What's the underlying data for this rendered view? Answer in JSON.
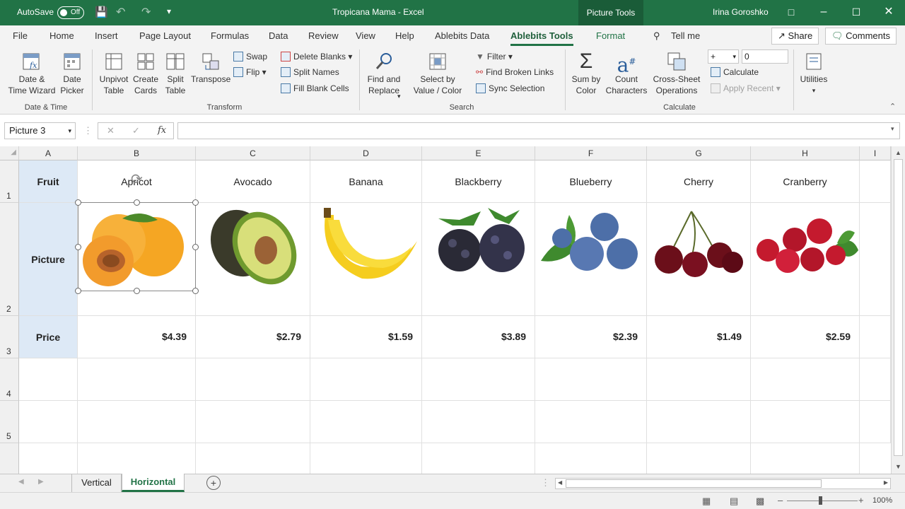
{
  "titlebar": {
    "autosave_label": "AutoSave",
    "autosave_state": "Off",
    "doc_title": "Tropicana Mama  -  Excel",
    "picture_tools": "Picture Tools",
    "user": "Irina Goroshko"
  },
  "menu": {
    "tabs": [
      "File",
      "Home",
      "Insert",
      "Page Layout",
      "Formulas",
      "Data",
      "Review",
      "View",
      "Help",
      "Ablebits Data",
      "Ablebits Tools",
      "Format"
    ],
    "tell_me": "Tell me",
    "share": "Share",
    "comments": "Comments"
  },
  "ribbon": {
    "date_wizard": "Date &\nTime Wizard",
    "date_picker": "Date\nPicker",
    "group_date": "Date & Time",
    "unpivot": "Unpivot\nTable",
    "create_cards": "Create\nCards",
    "split_table": "Split\nTable",
    "transpose": "Transpose",
    "swap": "Swap",
    "flip": "Flip",
    "delete_blanks": "Delete Blanks",
    "split_names": "Split Names",
    "fill_blank": "Fill Blank Cells",
    "group_transform": "Transform",
    "find_replace": "Find and\nReplace",
    "select_by_value": "Select by\nValue / Color",
    "filter": "Filter",
    "find_broken": "Find Broken Links",
    "sync_selection": "Sync Selection",
    "group_search": "Search",
    "sum_by_color": "Sum by\nColor",
    "count_chars": "Count\nCharacters",
    "cross_sheet": "Cross-Sheet\nOperations",
    "operator": "+",
    "operand": "0",
    "calculate": "Calculate",
    "apply_recent": "Apply Recent",
    "group_calculate": "Calculate",
    "utilities": "Utilities"
  },
  "formula_bar": {
    "name_box": "Picture 3",
    "fx": "fx",
    "formula": ""
  },
  "grid": {
    "columns": [
      "A",
      "B",
      "C",
      "D",
      "E",
      "F",
      "G",
      "H",
      "I"
    ],
    "rows": [
      "1",
      "2",
      "3",
      "4",
      "5"
    ],
    "row_labels": [
      "Fruit",
      "Picture",
      "Price"
    ],
    "fruits": [
      "Apricot",
      "Avocado",
      "Banana",
      "Blackberry",
      "Blueberry",
      "Cherry",
      "Cranberry"
    ],
    "prices": [
      "$4.39",
      "$2.79",
      "$1.59",
      "$3.89",
      "$2.39",
      "$1.49",
      "$2.59"
    ]
  },
  "sheets": {
    "tabs": [
      "Vertical",
      "Horizontal"
    ],
    "active": "Horizontal"
  },
  "status": {
    "zoom": "100%"
  }
}
